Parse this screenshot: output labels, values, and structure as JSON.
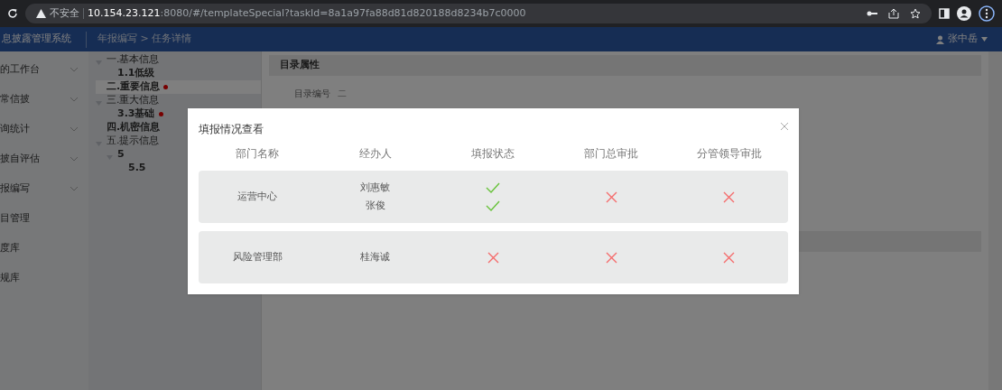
{
  "browser": {
    "security": "不安全",
    "host": "10.154.23.121",
    "path": ":8080/#/templateSpecial?taskId=8a1a97fa88d81d820188d8234b7c0000"
  },
  "header": {
    "app_title": "息披露管理系统",
    "breadcrumb": "年报编写 > 任务详情",
    "user": "张中岳"
  },
  "sidebar": {
    "items": [
      {
        "label": "的工作台",
        "expandable": true
      },
      {
        "label": "常信披",
        "expandable": true
      },
      {
        "label": "询统计",
        "expandable": true
      },
      {
        "label": "披自评估",
        "expandable": true
      },
      {
        "label": "报编写",
        "expandable": true
      },
      {
        "label": "目管理",
        "expandable": false
      },
      {
        "label": "度库",
        "expandable": false
      },
      {
        "label": "规库",
        "expandable": false
      }
    ]
  },
  "tree": [
    {
      "label": "一.基本信息",
      "expanded": true,
      "selected": false,
      "flagged": false,
      "children": [
        {
          "label": "1.1低级",
          "selected": false,
          "flagged": false
        }
      ]
    },
    {
      "label": "二.重要信息",
      "selected": true,
      "flagged": true
    },
    {
      "label": "三.重大信息",
      "expanded": true,
      "selected": false,
      "flagged": false,
      "children": [
        {
          "label": "3.3基础",
          "selected": false,
          "flagged": true
        }
      ]
    },
    {
      "label": "四.机密信息",
      "selected": false,
      "flagged": false
    },
    {
      "label": "五.提示信息",
      "expanded": true,
      "selected": false,
      "flagged": false,
      "children": [
        {
          "label": "5",
          "expanded": true,
          "selected": false,
          "flagged": false,
          "children": [
            {
              "label": "5.5",
              "selected": false,
              "flagged": false
            }
          ]
        }
      ]
    }
  ],
  "content": {
    "section_title": "目录属性",
    "field_label": "目录编号",
    "field_value": "二"
  },
  "dialog": {
    "title": "填报情况查看",
    "columns": [
      "部门名称",
      "经办人",
      "填报状态",
      "部门总审批",
      "分管领导审批"
    ],
    "rows": [
      {
        "department": "运营中心",
        "handlers": [
          "刘惠敏",
          "张俊"
        ],
        "filled": [
          true,
          true
        ],
        "dept_approved": false,
        "leader_approved": false
      },
      {
        "department": "风险管理部",
        "handlers": [
          "桂海诚"
        ],
        "filled": [
          false
        ],
        "dept_approved": false,
        "leader_approved": false
      }
    ]
  }
}
